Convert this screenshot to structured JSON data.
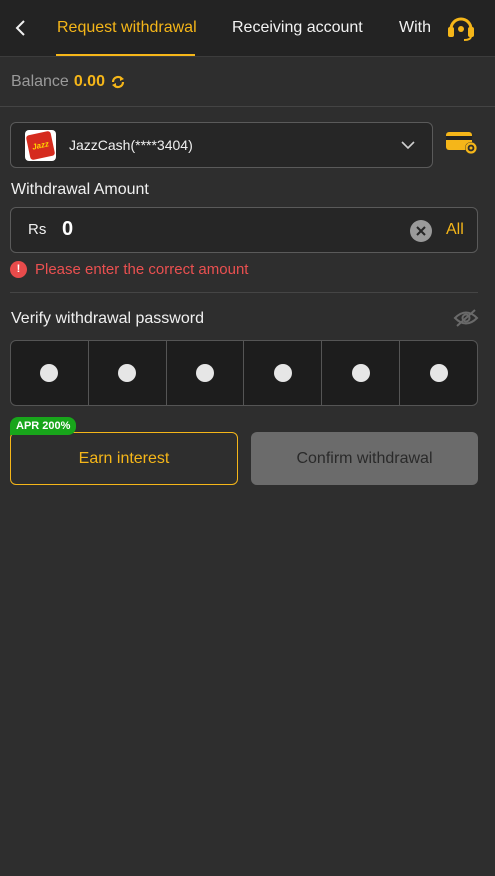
{
  "header": {
    "tabs": [
      {
        "label": "Request withdrawal",
        "active": true
      },
      {
        "label": "Receiving account",
        "active": false
      },
      {
        "label": "With",
        "active": false
      }
    ],
    "back_icon": "chevron-left-icon",
    "support_icon": "headset-icon"
  },
  "balance": {
    "label": "Balance",
    "value": "0.00",
    "refresh_icon": "refresh-icon"
  },
  "account": {
    "logo_text": "Jazz",
    "name": "JazzCash(****3404)",
    "dropdown_icon": "chevron-down-icon",
    "settings_icon": "card-settings-icon"
  },
  "amount": {
    "label": "Withdrawal Amount",
    "currency": "Rs",
    "value": "0",
    "clear_icon": "clear-icon",
    "all_label": "All",
    "error_icon": "!",
    "error_text": "Please enter the correct amount"
  },
  "password": {
    "label": "Verify withdrawal password",
    "visibility_icon": "eye-off-icon",
    "digits": 6
  },
  "actions": {
    "apr_badge": "APR 200%",
    "earn_label": "Earn interest",
    "confirm_label": "Confirm withdrawal"
  },
  "colors": {
    "accent": "#f5b619",
    "error": "#ea5050",
    "badge": "#18a51b",
    "background": "#2e2e2e"
  }
}
